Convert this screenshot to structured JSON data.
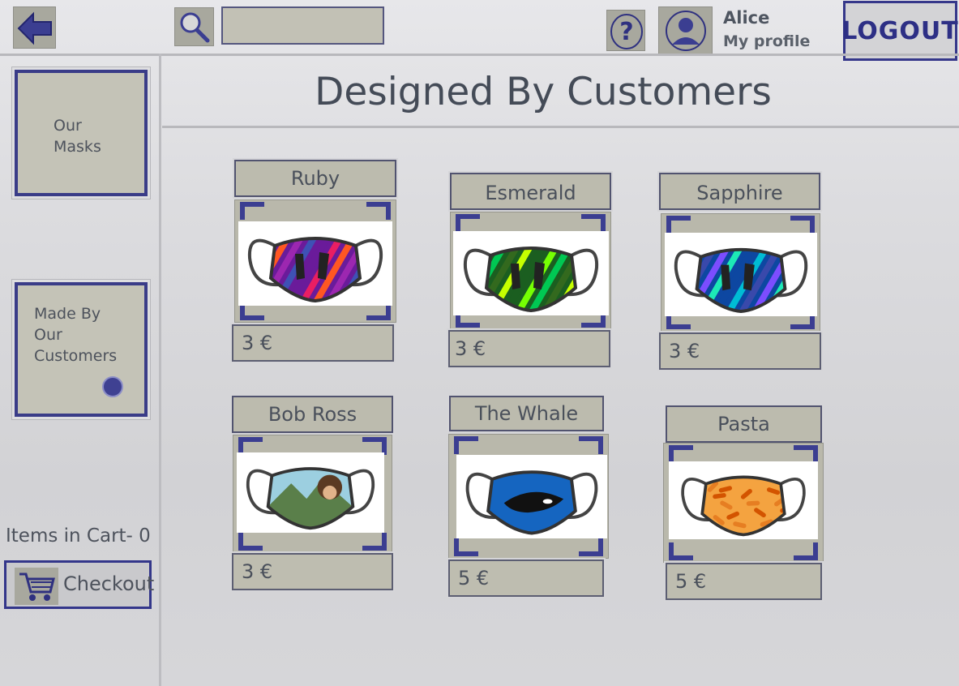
{
  "header": {
    "search": {
      "value": "",
      "placeholder": ""
    },
    "profile": {
      "name": "Alice",
      "link_label": "My profile"
    },
    "logout_label": "LOGOUT"
  },
  "page": {
    "title": "Designed By Customers"
  },
  "sidebar": {
    "items": [
      {
        "label": "Our\nMasks"
      },
      {
        "label": "Made By\nOur\nCustomers"
      }
    ],
    "cart": {
      "count_text": "Items in Cart- 0",
      "checkout_label": "Checkout"
    }
  },
  "products": [
    {
      "name": "Ruby",
      "price": "3 €",
      "pattern": "ruby"
    },
    {
      "name": "Esmerald",
      "price": "3 €",
      "pattern": "emerald"
    },
    {
      "name": "Sapphire",
      "price": "3 €",
      "pattern": "sapphire"
    },
    {
      "name": "Bob Ross",
      "price": "3 €",
      "pattern": "painting"
    },
    {
      "name": "The Whale",
      "price": "5 €",
      "pattern": "whale"
    },
    {
      "name": "Pasta",
      "price": "5 €",
      "pattern": "pasta"
    }
  ],
  "colors": {
    "accent": "#3b3e91",
    "panel": "#bdbcb0",
    "text": "#4a505b"
  }
}
